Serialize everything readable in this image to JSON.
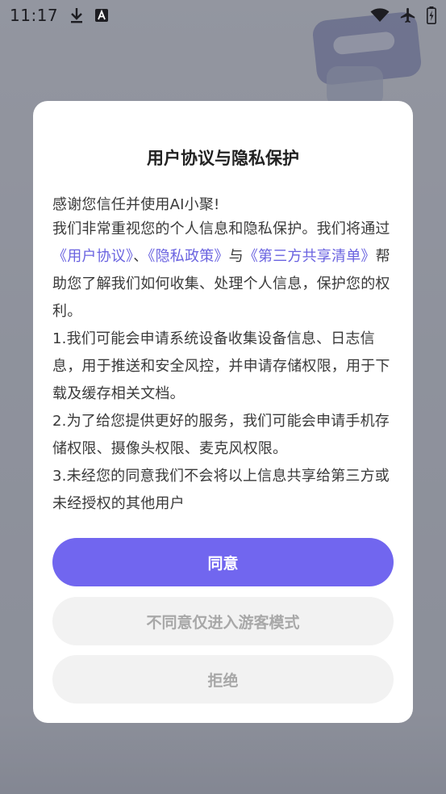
{
  "status_bar": {
    "time": "11:17",
    "left_icons": [
      "download-icon",
      "a-letter-icon"
    ],
    "right_icons": [
      "wifi-icon",
      "airplane-icon",
      "battery-charging-icon"
    ]
  },
  "dialog": {
    "title": "用户协议与隐私保护",
    "intro_line": "感谢您信任并使用AI小聚!",
    "paragraph1": {
      "before_links": "我们非常重视您的个人信息和隐私保护。我们将通过",
      "link_user_agreement": "《用户协议》",
      "sep1": "、",
      "link_privacy_policy": "《隐私政策》",
      "sep2": "与",
      "link_third_party_list": "《第三方共享清单》",
      "after_links": "帮助您了解我们如何收集、处理个人信息，保护您的权利。"
    },
    "item1": "1.我们可能会申请系统设备收集设备信息、日志信息，用于推送和安全风控，并申请存储权限，用于下载及缓存相关文档。",
    "item2": " 2.为了给您提供更好的服务，我们可能会申请手机存储权限、摄像头权限、麦克风权限。",
    "item3": "3.未经您的同意我们不会将以上信息共享给第三方或未经授权的其他用户",
    "buttons": {
      "agree": "同意",
      "guest_mode": "不同意仅进入游客模式",
      "reject": "拒绝"
    }
  },
  "colors": {
    "accent": "#7166ef",
    "link": "#6a63e0",
    "secondary_button_bg": "#f2f2f2",
    "secondary_button_text": "#a8a8a8"
  }
}
